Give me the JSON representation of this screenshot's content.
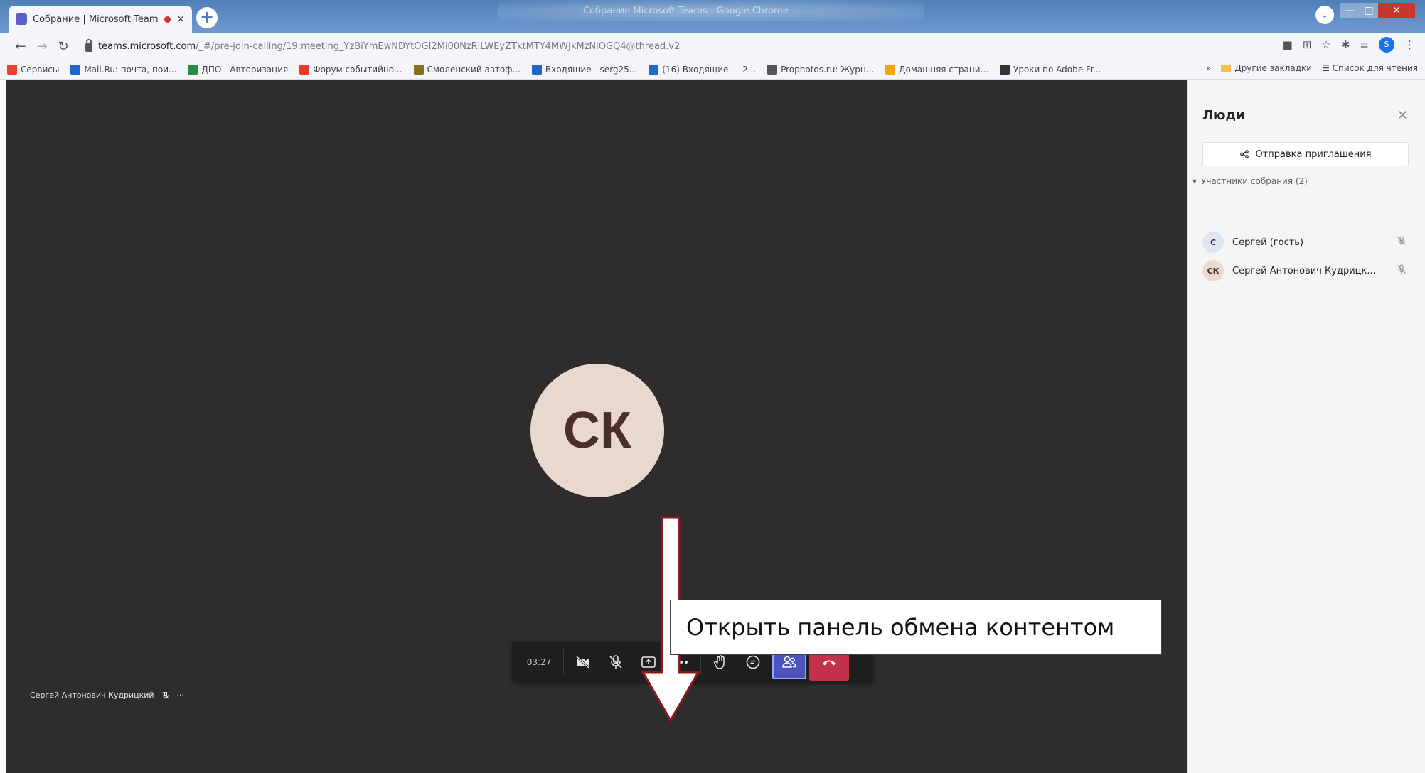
{
  "browser": {
    "window_title": "Собрание Microsoft Teams - Google Chrome",
    "tab": {
      "title": "Собрание | Microsoft Teams",
      "close": "×"
    },
    "new_tab": "+",
    "window_controls": {
      "minimize": "—",
      "maximize": "□",
      "close": "✕"
    },
    "url_host": "teams.microsoft.com",
    "url_path": "/_#/pre-join-calling/19:meeting_YzBiYmEwNDYtOGI2Mi00NzRlLWEyZTktMTY4MWJkMzNiOGQ4@thread.v2",
    "bookmarks": [
      {
        "label": "Сервисы",
        "color": "#e94235"
      },
      {
        "label": "Mail.Ru: почта, пои...",
        "color": "#1e66c9"
      },
      {
        "label": "ДПО - Авторизация",
        "color": "#2b8a3e"
      },
      {
        "label": "Форум событийно...",
        "color": "#e8392c"
      },
      {
        "label": "Смоленский автоф...",
        "color": "#8a6d1e"
      },
      {
        "label": "Входящие - serg25...",
        "color": "#1e66c9"
      },
      {
        "label": "(16) Входящие — 2...",
        "color": "#1e66c9"
      },
      {
        "label": "Prophotos.ru: Журн...",
        "color": "#555555"
      },
      {
        "label": "Домашняя страни...",
        "color": "#f2a60c"
      },
      {
        "label": "Уроки по Adobe Fr...",
        "color": "#333333"
      }
    ],
    "bookmarks_right": {
      "more": "»",
      "other": "Другие закладки",
      "reading_list": "Список для чтения"
    }
  },
  "meeting": {
    "avatar_initials": "СК",
    "participant_label": "Сергей Антонович Кудрицкий",
    "participant_more": "···",
    "timer": "03:27",
    "controls": {
      "camera": "camera-off",
      "mic": "mic-off",
      "share": "share-tray",
      "more": "more",
      "raise_hand": "raise-hand",
      "chat": "chat",
      "people": "people",
      "leave": "leave"
    },
    "callout_text": "Открыть панель обмена контентом"
  },
  "people_panel": {
    "title": "Люди",
    "close": "✕",
    "invite_label": "Отправка приглашения",
    "section_label": "Участники собрания (2)",
    "participants": [
      {
        "initials": "С",
        "name": "Сергей (гость)",
        "avatar_color": "#dfe6ef"
      },
      {
        "initials": "СК",
        "name": "Сергей Антонович Кудрицк...",
        "avatar_color": "#ecd9cf"
      }
    ]
  },
  "colors": {
    "stage_bg": "#2e2c2c",
    "people_active": "#4b53bc",
    "leave_red": "#c4314b",
    "arrow_fill": "#ffffff",
    "arrow_stroke": "#8b1a1a"
  }
}
